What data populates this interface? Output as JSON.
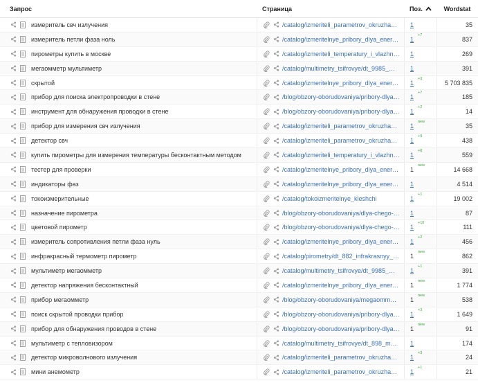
{
  "header": {
    "query_label": "Запрос",
    "page_label": "Страница",
    "pos_label": "Поз.",
    "wordstat_label": "Wordstat",
    "sort_icon": "chevron-up-icon"
  },
  "rows": [
    {
      "query": "измеритель свч излучения",
      "url": "/catalog/izmeriteli_parametrov_okruzhayu...",
      "pos": "1",
      "pos_link": true,
      "delta": "",
      "wordstat": "35"
    },
    {
      "query": "измеритель петли фаза ноль",
      "url": "/catalog/izmeritelnye_pribory_dlya_energe...",
      "pos": "1",
      "pos_link": true,
      "delta": "+7",
      "wordstat": "837"
    },
    {
      "query": "пирометры купить в москве",
      "url": "/catalog/izmeriteli_temperatury_i_vlazhno...",
      "pos": "1",
      "pos_link": true,
      "delta": "",
      "wordstat": "269"
    },
    {
      "query": "мегаомметр мультиметр",
      "url": "/catalog/multimetry_tsifrovye/dt_9985_mu...",
      "pos": "1",
      "pos_link": true,
      "delta": "",
      "wordstat": "391"
    },
    {
      "query": "скрытой",
      "url": "/catalog/izmeritelnye_pribory_dlya_energe...",
      "pos": "1",
      "pos_link": true,
      "delta": "+3",
      "wordstat": "5 703 835"
    },
    {
      "query": "прибор для поиска электропроводки в стене",
      "url": "/blog/obzory-oborudovaniya/pribory-dlya-p...",
      "pos": "1",
      "pos_link": true,
      "delta": "+7",
      "wordstat": "185"
    },
    {
      "query": "инструмент для обнаружения проводки в стене",
      "url": "/blog/obzory-oborudovaniya/pribory-dlya-p...",
      "pos": "1",
      "pos_link": true,
      "delta": "+2",
      "wordstat": "14"
    },
    {
      "query": "прибор для измерения свч излучения",
      "url": "/catalog/izmeriteli_parametrov_okruzhayu...",
      "pos": "1",
      "pos_link": true,
      "delta": "new",
      "wordstat": "35"
    },
    {
      "query": "детектор свч",
      "url": "/catalog/izmeriteli_parametrov_okruzhayu...",
      "pos": "1",
      "pos_link": true,
      "delta": "+9",
      "wordstat": "438"
    },
    {
      "query": "купить пирометры для измерения температуры бесконтактным методом",
      "url": "/catalog/izmeriteli_temperatury_i_vlazhno...",
      "pos": "1",
      "pos_link": true,
      "delta": "+8",
      "wordstat": "559"
    },
    {
      "query": "тестер для проверки",
      "url": "/catalog/izmeritelnye_pribory_dlya_energe...",
      "pos": "1",
      "pos_link": false,
      "delta": "new",
      "wordstat": "14 668"
    },
    {
      "query": "индикаторы фаз",
      "url": "/catalog/izmeritelnye_pribory_dlya_energe...",
      "pos": "1",
      "pos_link": true,
      "delta": "",
      "wordstat": "4 514"
    },
    {
      "query": "токоизмерительные",
      "url": "/catalog/tokoizmeritelnye_kleshchi",
      "pos": "1",
      "pos_link": true,
      "delta": "+1",
      "wordstat": "19 002"
    },
    {
      "query": "назначение пирометра",
      "url": "/blog/obzory-oborudovaniya/dlya-chego-n...",
      "pos": "1",
      "pos_link": true,
      "delta": "",
      "wordstat": "87"
    },
    {
      "query": "цветовой пирометр",
      "url": "/blog/obzory-oborudovaniya/dlya-chego-n...",
      "pos": "1",
      "pos_link": true,
      "delta": "+10",
      "wordstat": "111"
    },
    {
      "query": "измеритель сопротивления петли фаза нуль",
      "url": "/catalog/izmeritelnye_pribory_dlya_energe...",
      "pos": "1",
      "pos_link": true,
      "delta": "+2",
      "wordstat": "456"
    },
    {
      "query": "инфракрасный термометр пирометр",
      "url": "/catalog/pirometry/dt_882_infrakrasnyy_te...",
      "pos": "1",
      "pos_link": false,
      "delta": "new",
      "wordstat": "862"
    },
    {
      "query": "мультиметр мегаомметр",
      "url": "/catalog/multimetry_tsifrovye/dt_9985_mu...",
      "pos": "1",
      "pos_link": true,
      "delta": "+1",
      "wordstat": "391"
    },
    {
      "query": "детектор напряжения бесконтактный",
      "url": "/catalog/izmeritelnye_pribory_dlya_energe...",
      "pos": "1",
      "pos_link": false,
      "delta": "new",
      "wordstat": "1 774"
    },
    {
      "query": "прибор мегаомметр",
      "url": "/blog/obzory-oborudovaniya/megaommetr...",
      "pos": "1",
      "pos_link": false,
      "delta": "new",
      "wordstat": "538"
    },
    {
      "query": "поиск скрытой проводки прибор",
      "url": "/blog/obzory-oborudovaniya/pribory-dlya-p...",
      "pos": "1",
      "pos_link": true,
      "delta": "+3",
      "wordstat": "1 649"
    },
    {
      "query": "прибор для обнаружения проводов в стене",
      "url": "/blog/obzory-oborudovaniya/pribory-dlya-p...",
      "pos": "1",
      "pos_link": false,
      "delta": "new",
      "wordstat": "91"
    },
    {
      "query": "мультиметр с тепловизором",
      "url": "/catalog/multimetry_tsifrovye/dt_898_mult...",
      "pos": "1",
      "pos_link": true,
      "delta": "",
      "wordstat": "174"
    },
    {
      "query": "детектор микроволнового излучения",
      "url": "/catalog/izmeriteli_parametrov_okruzhayu...",
      "pos": "1",
      "pos_link": true,
      "delta": "+3",
      "wordstat": "24"
    },
    {
      "query": "мини анемометр",
      "url": "/catalog/izmeriteli_parametrov_okruzhayu...",
      "pos": "1",
      "pos_link": true,
      "delta": "+1",
      "wordstat": "21"
    }
  ],
  "icons": {
    "row_icons": [
      "share-icon",
      "document-icon"
    ],
    "page_icons": [
      "attachment-icon",
      "share-icon"
    ]
  },
  "colors": {
    "link": "#3b6fb6",
    "delta": "#3aa53a"
  }
}
